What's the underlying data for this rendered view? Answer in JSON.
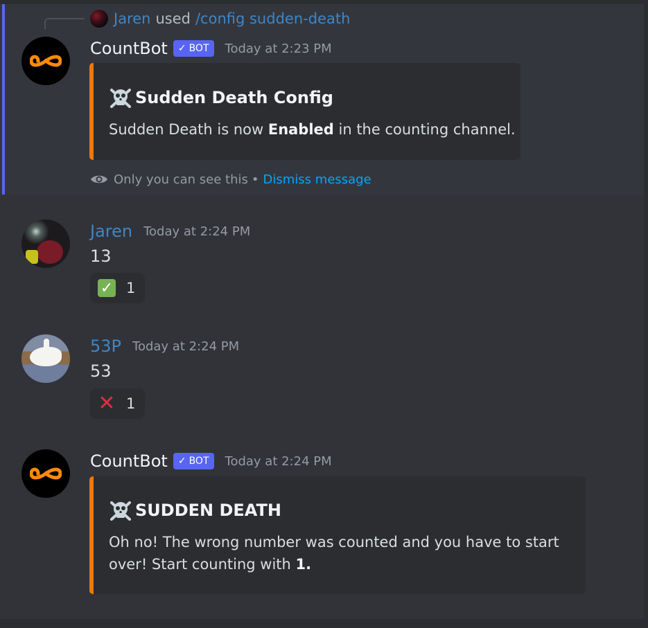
{
  "colors": {
    "background": "#313338",
    "embed_accent": "#f0780a",
    "ephemeral_bar": "#5865f2",
    "username_blue": "#3e86c6",
    "link": "#00a8fc"
  },
  "messages": [
    {
      "reply": {
        "user": "Jaren",
        "verb": "used",
        "command": "/config sudden-death"
      },
      "author": "CountBot",
      "bot_tag": "BOT",
      "timestamp": "Today at 2:23 PM",
      "embed": {
        "icon": "skull-crossbones-icon",
        "title": "Sudden Death Config",
        "desc_pre": "Sudden Death is now ",
        "desc_bold": "Enabled",
        "desc_post": " in the counting channel."
      },
      "ephemeral_note": "Only you can see this",
      "separator": "•",
      "dismiss_label": "Dismiss message"
    },
    {
      "author": "Jaren",
      "timestamp": "Today at 2:24 PM",
      "text": "13",
      "reaction": {
        "emoji": "white-check-mark",
        "count": "1"
      }
    },
    {
      "author": "53P",
      "timestamp": "Today at 2:24 PM",
      "text": "53",
      "reaction": {
        "emoji": "x-cross",
        "count": "1"
      }
    },
    {
      "author": "CountBot",
      "bot_tag": "BOT",
      "timestamp": "Today at 2:24 PM",
      "embed": {
        "icon": "skull-crossbones-icon",
        "title": "SUDDEN DEATH",
        "desc_line1": "Oh no! The wrong number was counted and you have to start",
        "desc_line2_pre": "over! Start counting with ",
        "desc_line2_bold": "1."
      }
    }
  ]
}
